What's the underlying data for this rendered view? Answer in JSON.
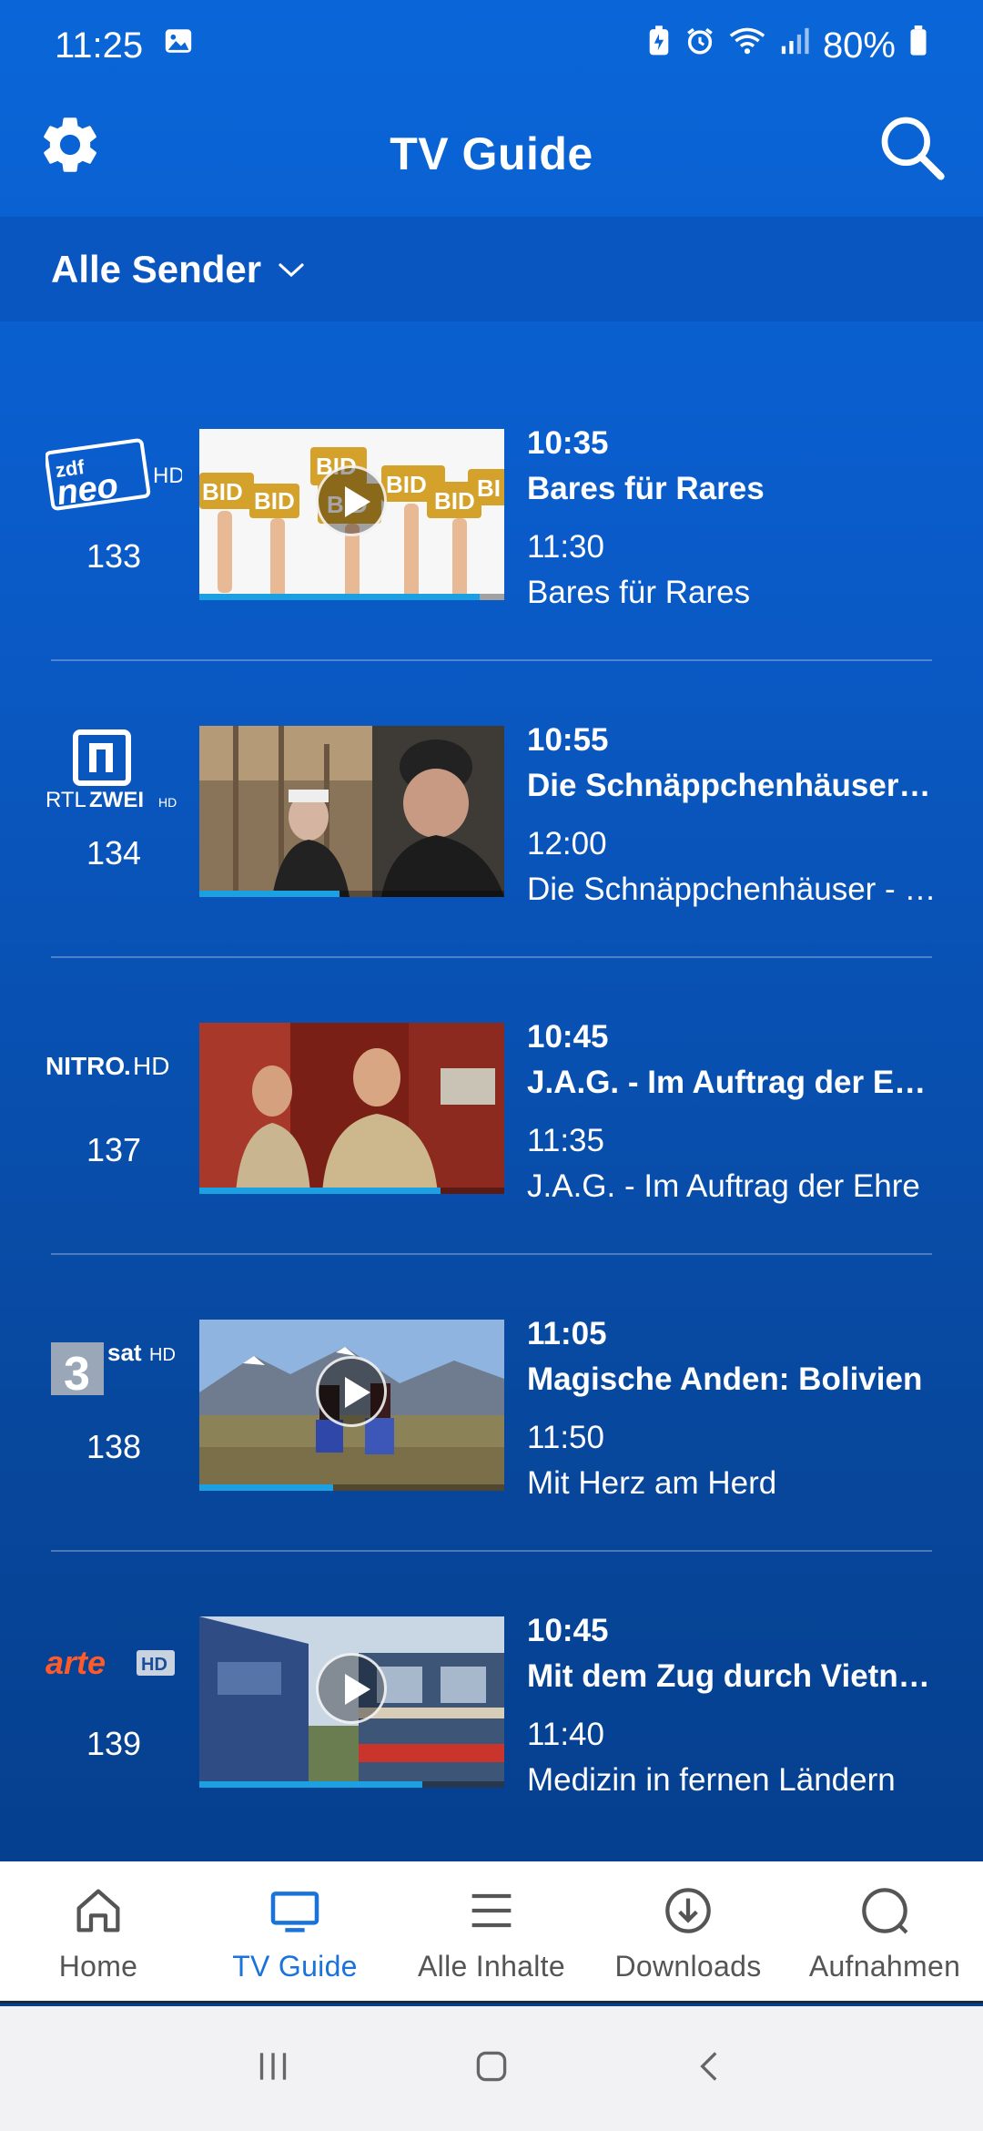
{
  "status_bar": {
    "time": "11:25",
    "battery": "80%",
    "icons": [
      "image-icon",
      "battery-saver-icon",
      "alarm-icon",
      "wifi-icon",
      "signal-icon",
      "battery-icon"
    ]
  },
  "app_bar": {
    "title": "TV Guide",
    "left_icon": "gear-icon",
    "right_icon": "search-icon"
  },
  "filter": {
    "label": "Alle Sender"
  },
  "channels": [
    {
      "number": "133",
      "logo": {
        "line1": "zdf",
        "line2": "neo",
        "suffix": "HD"
      },
      "now_time": "10:35",
      "now_title": "Bares für Rares",
      "next_time": "11:30",
      "next_title": "Bares für Rares",
      "progress": 0.92,
      "has_play": true
    },
    {
      "number": "134",
      "logo": {
        "line1": "RTL",
        "line2": "ZWEI",
        "suffix": "HD"
      },
      "now_time": "10:55",
      "now_title": "Die Schnäppchenhäuser - Der Traum vom Eigenheim",
      "next_time": "12:00",
      "next_title": "Die Schnäppchenhäuser - Der Traum vom Eigenheim",
      "progress": 0.46,
      "has_play": false
    },
    {
      "number": "137",
      "logo": {
        "line1": "NITRO",
        "line2": ".",
        "suffix": "HD"
      },
      "now_time": "10:45",
      "now_title": "J.A.G. - Im Auftrag der Ehre",
      "next_time": "11:35",
      "next_title": "J.A.G. - Im Auftrag der Ehre",
      "progress": 0.79,
      "has_play": false
    },
    {
      "number": "138",
      "logo": {
        "line1": "3",
        "line2": "sat",
        "suffix": "HD"
      },
      "now_time": "11:05",
      "now_title": "Magische Anden: Bolivien",
      "next_time": "11:50",
      "next_title": "Mit Herz am Herd",
      "progress": 0.44,
      "has_play": true
    },
    {
      "number": "139",
      "logo": {
        "line1": "arte",
        "line2": "",
        "suffix": "HD"
      },
      "now_time": "10:45",
      "now_title": "Mit dem Zug durch Vietnam",
      "next_time": "11:40",
      "next_title": "Medizin in fernen Ländern",
      "progress": 0.73,
      "has_play": true
    }
  ],
  "bottom_nav": [
    {
      "label": "Home",
      "icon": "home-icon",
      "active": false
    },
    {
      "label": "TV Guide",
      "icon": "tv-icon",
      "active": true
    },
    {
      "label": "Alle Inhalte",
      "icon": "menu-lines-icon",
      "active": false
    },
    {
      "label": "Downloads",
      "icon": "download-icon",
      "active": false
    },
    {
      "label": "Aufnahmen",
      "icon": "record-icon",
      "active": false
    }
  ],
  "colors": {
    "brand_blue": "#0a66d8",
    "accent_progress": "#1ba1e2",
    "active_nav": "#1a73d9"
  }
}
